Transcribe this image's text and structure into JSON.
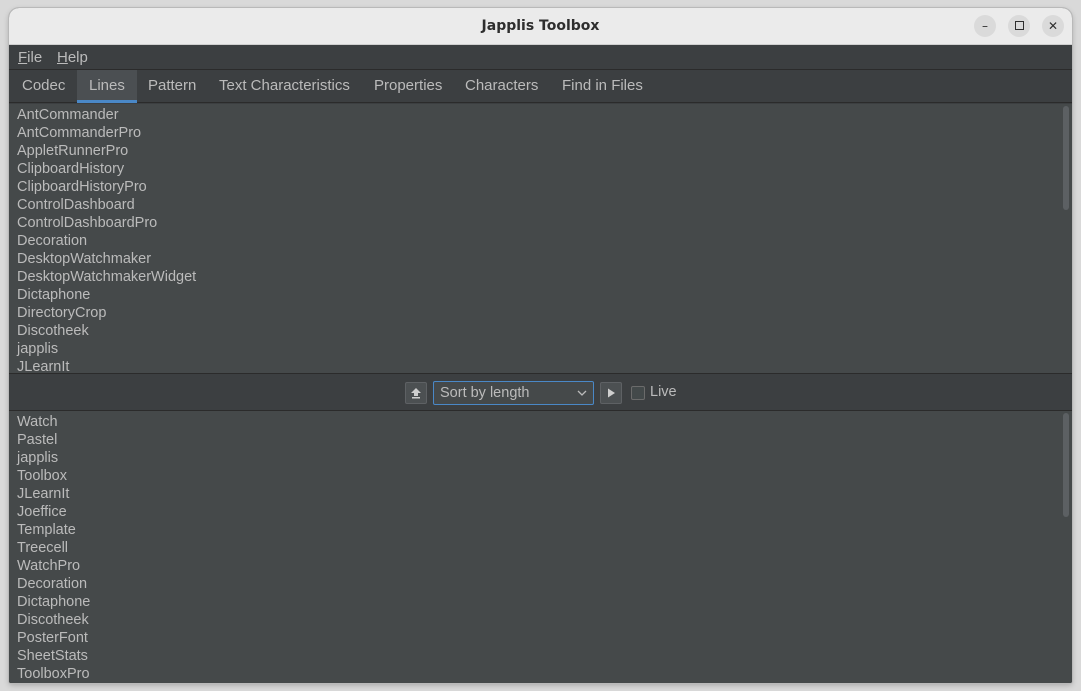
{
  "window": {
    "title": "Japplis Toolbox",
    "controls": {
      "minimize": "–",
      "close": "✕"
    }
  },
  "menubar": {
    "items": [
      {
        "label": "File",
        "mnemonic": "F",
        "rest": "ile"
      },
      {
        "label": "Help",
        "mnemonic": "H",
        "rest": "elp"
      }
    ]
  },
  "tabs": [
    {
      "label": "Codec",
      "active": false
    },
    {
      "label": "Lines",
      "active": true
    },
    {
      "label": "Pattern",
      "active": false
    },
    {
      "label": "Text Characteristics",
      "active": false
    },
    {
      "label": "Properties",
      "active": false
    },
    {
      "label": "Characters",
      "active": false
    },
    {
      "label": "Find in Files",
      "active": false
    }
  ],
  "input_lines": [
    "AntCommander",
    "AntCommanderPro",
    "AppletRunnerPro",
    "ClipboardHistory",
    "ClipboardHistoryPro",
    "ControlDashboard",
    "ControlDashboardPro",
    "Decoration",
    "DesktopWatchmaker",
    "DesktopWatchmakerWidget",
    "Dictaphone",
    "DirectoryCrop",
    "Discotheek",
    "japplis",
    "JLearnIt"
  ],
  "toolbar": {
    "sort_option": "Sort by length",
    "live_label": "Live",
    "live_checked": false
  },
  "output_lines": [
    "Watch",
    "Pastel",
    "japplis",
    "Toolbox",
    "JLearnIt",
    "Joeffice",
    "Template",
    "Treecell",
    "WatchPro",
    "Decoration",
    "Dictaphone",
    "Discotheek",
    "PosterFont",
    "SheetStats",
    "ToolboxPro"
  ],
  "icons": {
    "upload": "upload-icon",
    "run": "play-icon",
    "dropdown": "chevron-down-icon"
  },
  "colors": {
    "accent": "#4a88c7",
    "background": "#3c3f41",
    "text": "#bbbbbb"
  }
}
